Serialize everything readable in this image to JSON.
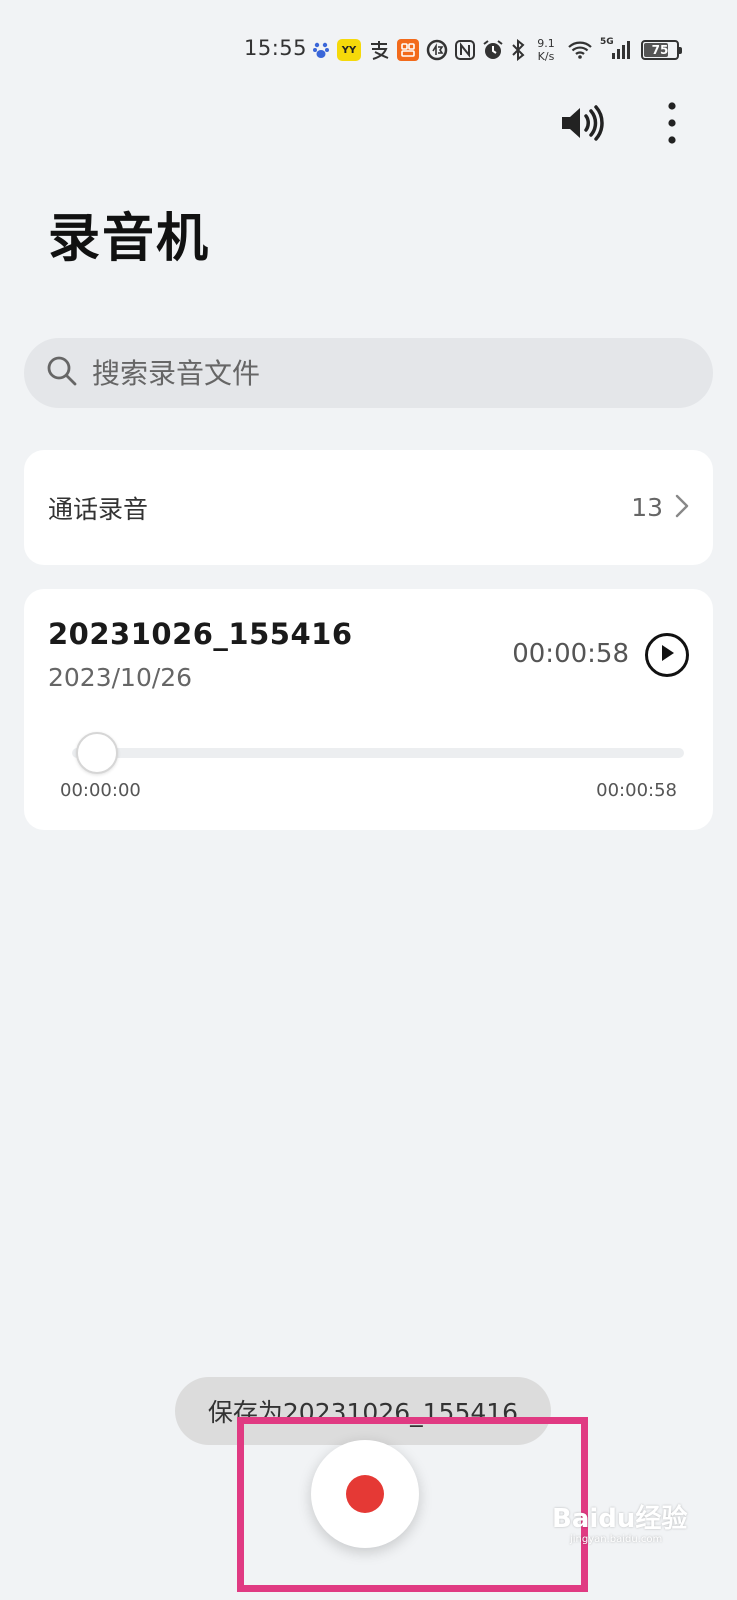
{
  "status_bar": {
    "time": "15:55",
    "net_speed_value": "9.1",
    "net_speed_unit": "K/s",
    "network": "5G",
    "battery": "75",
    "icons": [
      "baidu-paw-icon",
      "yy-app-icon",
      "alipay-icon",
      "taobao-icon",
      "data-saver-icon",
      "nfc-icon",
      "alarm-icon",
      "bluetooth-icon",
      "wifi-icon",
      "signal-icon",
      "battery-icon"
    ]
  },
  "header": {
    "title": "录音机",
    "actions": [
      "speaker-icon",
      "more-vert-icon"
    ]
  },
  "search": {
    "placeholder": "搜索录音文件"
  },
  "call_recordings": {
    "label": "通话录音",
    "count": "13"
  },
  "recording": {
    "name": "20231026_155416",
    "date": "2023/10/26",
    "duration": "00:00:58",
    "position": "00:00:00",
    "total": "00:00:58",
    "progress": 0
  },
  "toast": {
    "text": "保存为20231026_155416"
  },
  "watermark": {
    "brand": "Baidu经验",
    "sub": "jingyan.baidu.com"
  },
  "colors": {
    "background": "#f1f3f5",
    "card": "#ffffff",
    "record_red": "#e53935",
    "highlight": "#e03a82"
  }
}
